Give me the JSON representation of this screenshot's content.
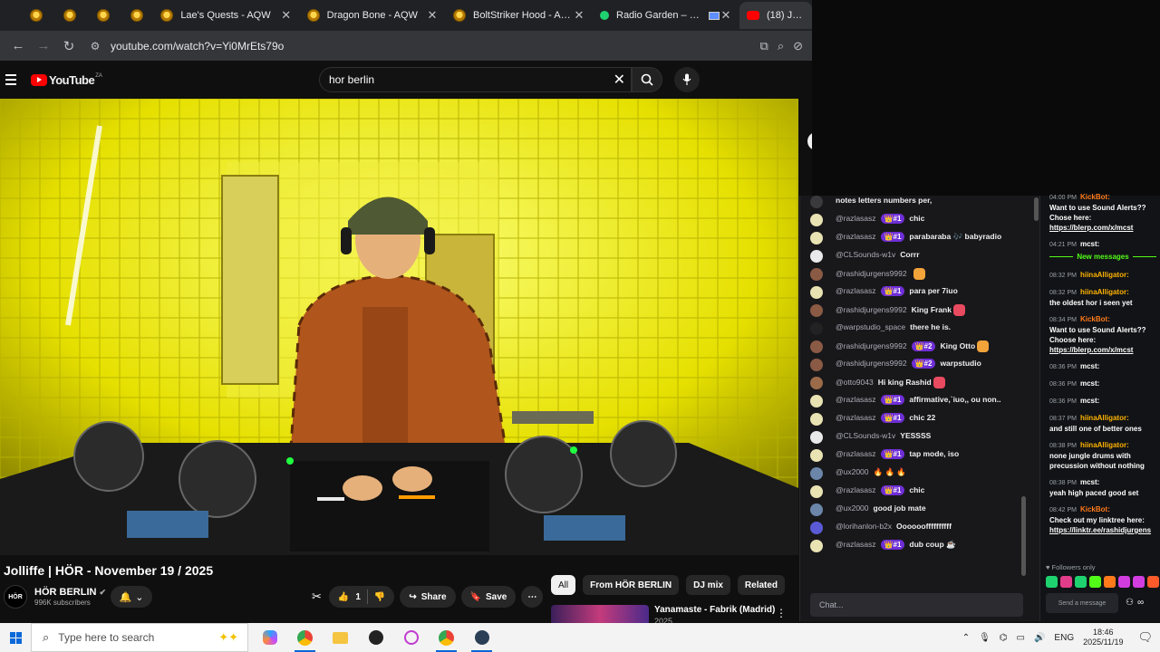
{
  "browser": {
    "tabs": [
      {
        "label": "Lae's Quests - AQW",
        "icon": "aqw-icon"
      },
      {
        "label": "Dragon Bone - AQW",
        "icon": "aqw-icon"
      },
      {
        "label": "BoltStriker Hood - AQW",
        "icon": "aqw-icon"
      },
      {
        "label": "Radio Garden – Glob",
        "icon": "radio-garden-icon"
      },
      {
        "label": "(18) Jolliffe | H",
        "icon": "youtube-icon"
      }
    ],
    "close_glyph": "✕",
    "url": "youtube.com/watch?v=Yi0MrEts79o"
  },
  "youtube": {
    "logo_text": "YouTube",
    "logo_region": "ZA",
    "search_value": "hor berlin",
    "video_title": "Jolliffe | HÖR - November 19 / 2025",
    "channel_name": "HÖR BERLIN",
    "channel_avatar_text": "HÖR",
    "subscribers": "996K subscribers",
    "like_count": "1",
    "share_label": "Share",
    "save_label": "Save",
    "chips": [
      "All",
      "From HÖR BERLIN",
      "DJ mix",
      "Related"
    ],
    "rec_title": "Yanamaste - Fabrik (Madrid)",
    "rec_sub": "2025"
  },
  "chat": {
    "lines": [
      {
        "user": "",
        "badge": "",
        "msg": "notes letters numbers per,",
        "av": "#3a3a3d"
      },
      {
        "user": "@razlasasz",
        "badge": "👑#1",
        "msg": "chic",
        "av": "#e9e2b3"
      },
      {
        "user": "@razlasasz",
        "badge": "👑#1",
        "msg": "parabaraba 🎶 babyradio",
        "av": "#e9e2b3"
      },
      {
        "user": "@CLSounds-w1v",
        "badge": "",
        "msg": "Corrr",
        "av": "#e9e9e9"
      },
      {
        "user": "@rashidjurgens9992",
        "badge": "",
        "msg": "",
        "av": "#8a5a44"
      },
      {
        "user": "@razlasasz",
        "badge": "👑#1",
        "msg": "para per 7iuo",
        "av": "#e9e2b3"
      },
      {
        "user": "@rashidjurgens9992",
        "badge": "",
        "msg": "King Frank",
        "av": "#8a5a44"
      },
      {
        "user": "@warpstudio_space",
        "badge": "",
        "msg": "there he is.",
        "av": "#222222"
      },
      {
        "user": "@rashidjurgens9992",
        "badge": "👑#2",
        "msg": "King Otto",
        "av": "#8a5a44"
      },
      {
        "user": "@rashidjurgens9992",
        "badge": "👑#2",
        "msg": "warpstudio",
        "av": "#8a5a44"
      },
      {
        "user": "@otto9043",
        "badge": "",
        "msg": "Hi king Rashid",
        "av": "#9c6b4a"
      },
      {
        "user": "@razlasasz",
        "badge": "👑#1",
        "msg": "affirmative,`iuo,, ou non..",
        "av": "#e9e2b3"
      },
      {
        "user": "@razlasasz",
        "badge": "👑#1",
        "msg": "chic 22",
        "av": "#e9e2b3"
      },
      {
        "user": "@CLSounds-w1v",
        "badge": "",
        "msg": "YESSSS",
        "av": "#e9e9e9"
      },
      {
        "user": "@razlasasz",
        "badge": "👑#1",
        "msg": "tap mode, iso",
        "av": "#e9e2b3"
      },
      {
        "user": "@ux2000",
        "badge": "",
        "msg": "🔥 🔥 🔥",
        "av": "#6b86a8"
      },
      {
        "user": "@razlasasz",
        "badge": "👑#1",
        "msg": "chic",
        "av": "#e9e2b3"
      },
      {
        "user": "@ux2000",
        "badge": "",
        "msg": "good job mate",
        "av": "#6b86a8"
      },
      {
        "user": "@lorihanlon-b2x",
        "badge": "",
        "msg": "Ooooooffffffffff",
        "av": "#5a5ad6"
      },
      {
        "user": "@razlasasz",
        "badge": "👑#1",
        "msg": "dub coup ☕",
        "av": "#e9e2b3"
      }
    ],
    "input_placeholder": "Chat..."
  },
  "kick": {
    "lines": [
      {
        "time": "04:00 PM",
        "user": "KickBot:",
        "ucolor": "#ff7a1a",
        "msg": "Want to use Sound Alerts?? Chose here:",
        "link": "https://blerp.com/x/mcst"
      },
      {
        "time": "04:21 PM",
        "user": "mcst:",
        "ucolor": "#ffffff",
        "msg": "",
        "link": ""
      },
      {
        "time": "08:32 PM",
        "user": "hiinaAlligator:",
        "ucolor": "#ffb300",
        "msg": "",
        "link": ""
      },
      {
        "time": "08:32 PM",
        "user": "hiinaAlligator:",
        "ucolor": "#ffb300",
        "msg": "the oldest hor i seen yet",
        "link": ""
      },
      {
        "time": "08:34 PM",
        "user": "KickBot:",
        "ucolor": "#ff7a1a",
        "msg": "Want to use Sound Alerts?? Choose here:",
        "link": "https://blerp.com/x/mcst"
      },
      {
        "time": "08:36 PM",
        "user": "mcst:",
        "ucolor": "#ffffff",
        "msg": "",
        "link": ""
      },
      {
        "time": "08:36 PM",
        "user": "mcst:",
        "ucolor": "#ffffff",
        "msg": "",
        "link": ""
      },
      {
        "time": "08:36 PM",
        "user": "mcst:",
        "ucolor": "#ffffff",
        "msg": "",
        "link": ""
      },
      {
        "time": "08:37 PM",
        "user": "hiinaAlligator:",
        "ucolor": "#ffb300",
        "msg": "and still one of better ones",
        "link": ""
      },
      {
        "time": "08:38 PM",
        "user": "hiinaAlligator:",
        "ucolor": "#ffb300",
        "msg": "none jungle drums with precussion without nothing",
        "link": ""
      },
      {
        "time": "08:38 PM",
        "user": "mcst:",
        "ucolor": "#ffffff",
        "msg": "yeah high paced good set",
        "link": ""
      },
      {
        "time": "08:42 PM",
        "user": "KickBot:",
        "ucolor": "#ff7a1a",
        "msg": "Check out my linktree here:",
        "link": "https://linktr.ee/rashidjurgens"
      }
    ],
    "new_messages": "New messages",
    "followers_only": "Followers only",
    "send_placeholder": "Send a message"
  },
  "taskbar": {
    "search_placeholder": "Type here to search",
    "lang": "ENG",
    "time": "18:46",
    "date": "2025/11/19"
  }
}
